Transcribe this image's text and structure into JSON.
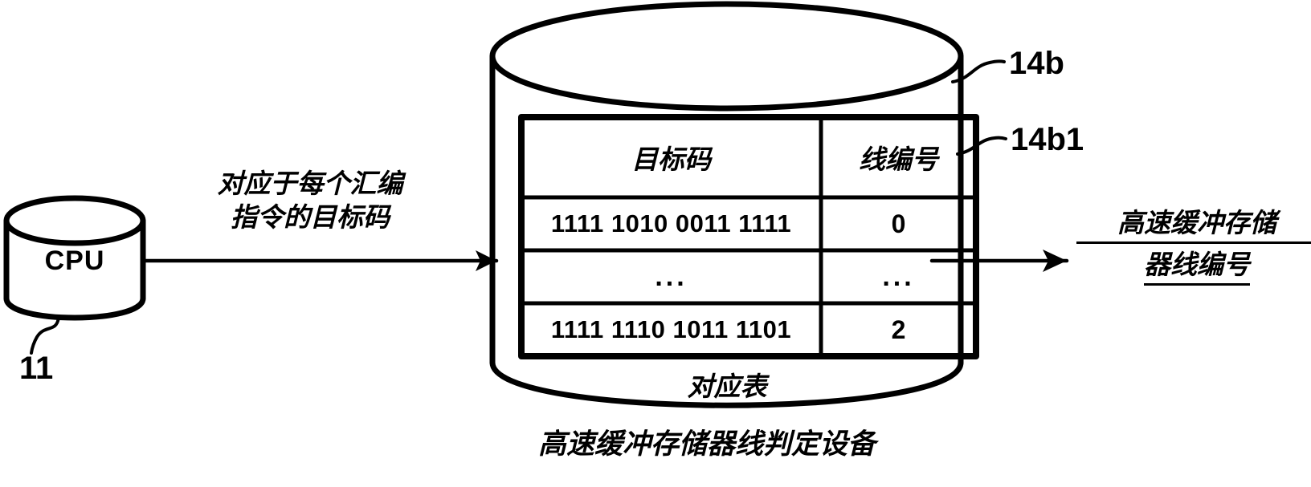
{
  "figure": {
    "type": "patent-diagram",
    "bottom_caption": "高速缓冲存储器线判定设备"
  },
  "cpu_block": {
    "label": "CPU",
    "reference_numeral": "11",
    "shape": "cylinder"
  },
  "flow_in": {
    "label_line1": "对应于每个汇编",
    "label_line2": "指令的目标码",
    "arrow": "right-arrow"
  },
  "flow_out": {
    "label_line1": "高速缓冲存储",
    "label_line2": "器线编号",
    "arrow": "right-arrow"
  },
  "device_cylinder": {
    "reference_numeral": "14b",
    "inner_caption": "对应表"
  },
  "table": {
    "reference_numeral": "14b1",
    "columns": [
      {
        "header": "目标码"
      },
      {
        "header": "线编号"
      }
    ],
    "rows": [
      {
        "object_code": "1111 1010 0011 1111",
        "line_number": "0"
      },
      {
        "object_code": "...",
        "line_number": "..."
      },
      {
        "object_code": "1111 1110 1011 1101",
        "line_number": "2"
      }
    ]
  },
  "colors": {
    "ink": "#000000",
    "paper": "#ffffff"
  }
}
